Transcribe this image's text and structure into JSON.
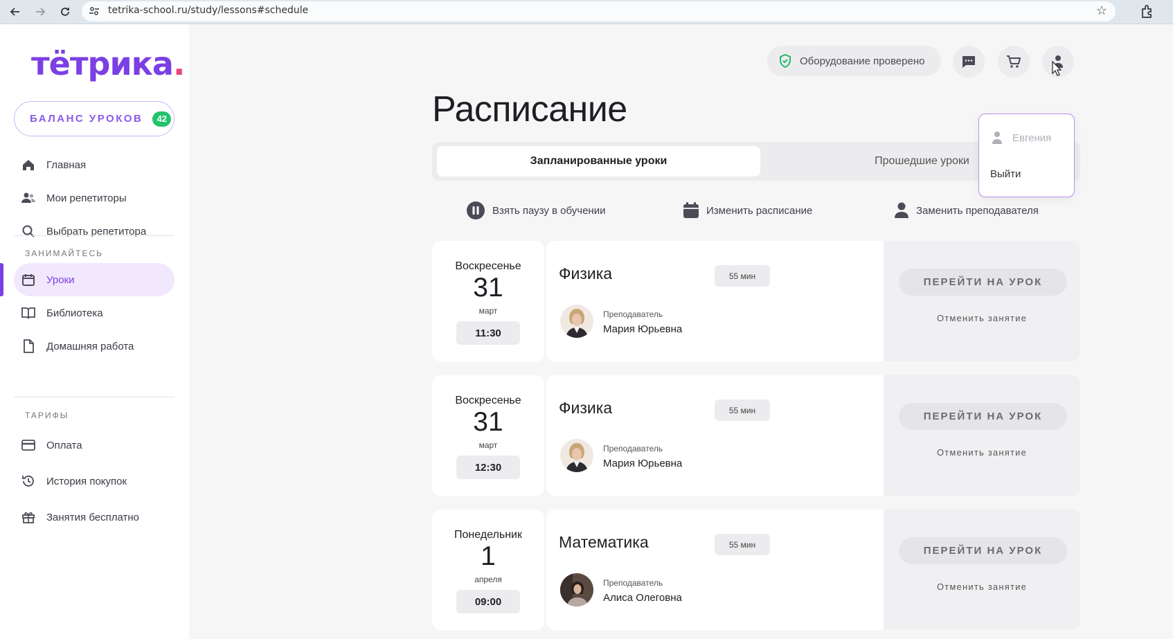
{
  "browser": {
    "url": "tetrika-school.ru/study/lessons#schedule"
  },
  "sidebar": {
    "logo_main": "тётрика",
    "logo_dot": ".",
    "balance_label": "БАЛАНС УРОКОВ",
    "balance_count": "42",
    "items_main": [
      {
        "label": "Главная",
        "icon": "home-icon"
      },
      {
        "label": "Мои репетиторы",
        "icon": "users-icon"
      },
      {
        "label": "Выбрать репетитора",
        "icon": "search-icon"
      }
    ],
    "section_study": "ЗАНИМАЙТЕСЬ",
    "items_study": [
      {
        "label": "Уроки",
        "icon": "calendar-icon",
        "active": true
      },
      {
        "label": "Библиотека",
        "icon": "book-icon"
      },
      {
        "label": "Домашняя работа",
        "icon": "document-icon"
      }
    ],
    "section_tariffs": "ТАРИФЫ",
    "items_tariffs": [
      {
        "label": "Оплата",
        "icon": "credit-card-icon"
      },
      {
        "label": "История покупок",
        "icon": "history-icon"
      },
      {
        "label": "Занятия бесплатно",
        "icon": "gift-icon"
      }
    ]
  },
  "header": {
    "equipment_status": "Оборудование проверено",
    "icons": [
      "chat-icon",
      "cart-icon",
      "user-icon"
    ]
  },
  "main": {
    "title": "Расписание",
    "tabs": [
      "Запланированные уроки",
      "Прошедшие уроки"
    ],
    "actions": [
      {
        "label": "Взять паузу в обучении",
        "icon": "pause-icon"
      },
      {
        "label": "Изменить расписание",
        "icon": "calendar-icon"
      },
      {
        "label": "Заменить преподавателя",
        "icon": "user-icon"
      }
    ],
    "lessons": [
      {
        "weekday": "Воскресенье",
        "day": "31",
        "month": "март",
        "time": "11:30",
        "subject": "Физика",
        "duration": "55 мин",
        "teacher_label": "Преподаватель",
        "teacher": "Мария Юрьевна",
        "go_label": "ПЕРЕЙТИ НА УРОК",
        "cancel_label": "Отменить занятие"
      },
      {
        "weekday": "Воскресенье",
        "day": "31",
        "month": "март",
        "time": "12:30",
        "subject": "Физика",
        "duration": "55 мин",
        "teacher_label": "Преподаватель",
        "teacher": "Мария Юрьевна",
        "go_label": "ПЕРЕЙТИ НА УРОК",
        "cancel_label": "Отменить занятие"
      },
      {
        "weekday": "Понедельник",
        "day": "1",
        "month": "апреля",
        "time": "09:00",
        "subject": "Математика",
        "duration": "55 мин",
        "teacher_label": "Преподаватель",
        "teacher": "Алиса Олеговна",
        "go_label": "ПЕРЕЙТИ НА УРОК",
        "cancel_label": "Отменить занятие"
      }
    ]
  },
  "dropdown": {
    "user_name": "Евгения",
    "logout": "Выйти"
  }
}
